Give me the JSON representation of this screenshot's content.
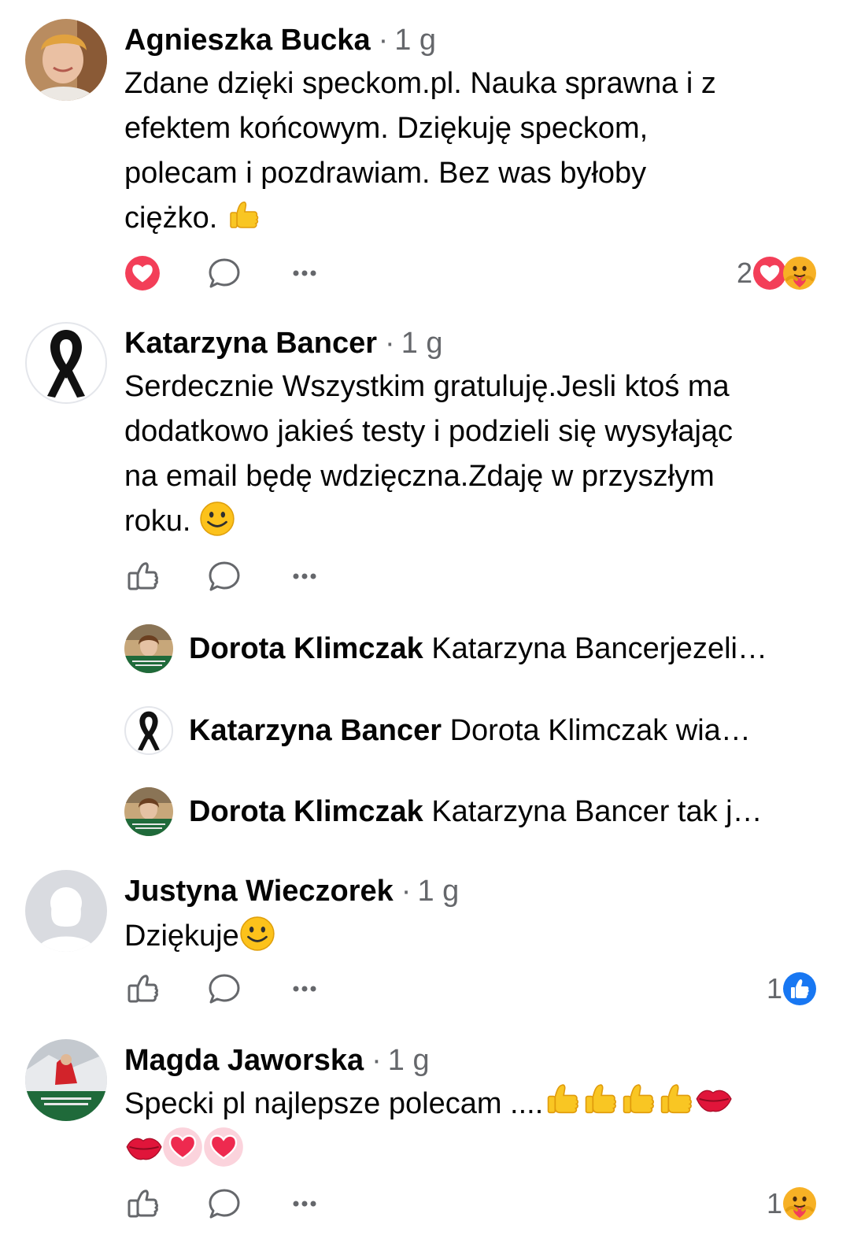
{
  "comments": [
    {
      "author": "Agnieszka Bucka",
      "time": "1 g",
      "lines": [
        "Zdane dzięki speckom.pl.  Nauka sprawna i z",
        "efektem końcowym. Dziękuję speckom,",
        "polecam i pozdrawiam. Bez was byłoby",
        "ciężko."
      ],
      "reaction_count": "2",
      "liked": true,
      "reactions": [
        "heart-reaction-icon",
        "care-reaction-icon"
      ]
    },
    {
      "author": "Katarzyna Bancer",
      "time": "1 g",
      "lines": [
        "Serdecznie Wszystkim gratuluję.Jesli ktoś ma",
        "dodatkowo jakieś testy i podzieli się wysyłając",
        "na email będę wdzięczna.Zdaję w przyszłym",
        "roku."
      ],
      "replies": [
        {
          "author": "Dorota Klimczak",
          "text": "Katarzyna Bancerjezeli…"
        },
        {
          "author": "Katarzyna Bancer",
          "text": "Dorota Klimczak  wia…"
        },
        {
          "author": "Dorota Klimczak",
          "text": "Katarzyna Bancer tak j…"
        }
      ]
    },
    {
      "author": "Justyna Wieczorek",
      "time": "1 g",
      "lines": [
        "Dziękuje"
      ],
      "reaction_count": "1",
      "reactions": [
        "like-reaction-icon"
      ]
    },
    {
      "author": "Magda Jaworska",
      "time": "1 g",
      "lines": [
        "Specki pl najlepsze polecam ...."
      ],
      "reaction_count": "1",
      "reactions": [
        "care-reaction-icon"
      ]
    }
  ],
  "separator": "·",
  "colors": {
    "like_blue": "#1877f2",
    "love_red": "#f33e58",
    "secondary_text": "#65676b",
    "care_yellow": "#f7b125"
  }
}
